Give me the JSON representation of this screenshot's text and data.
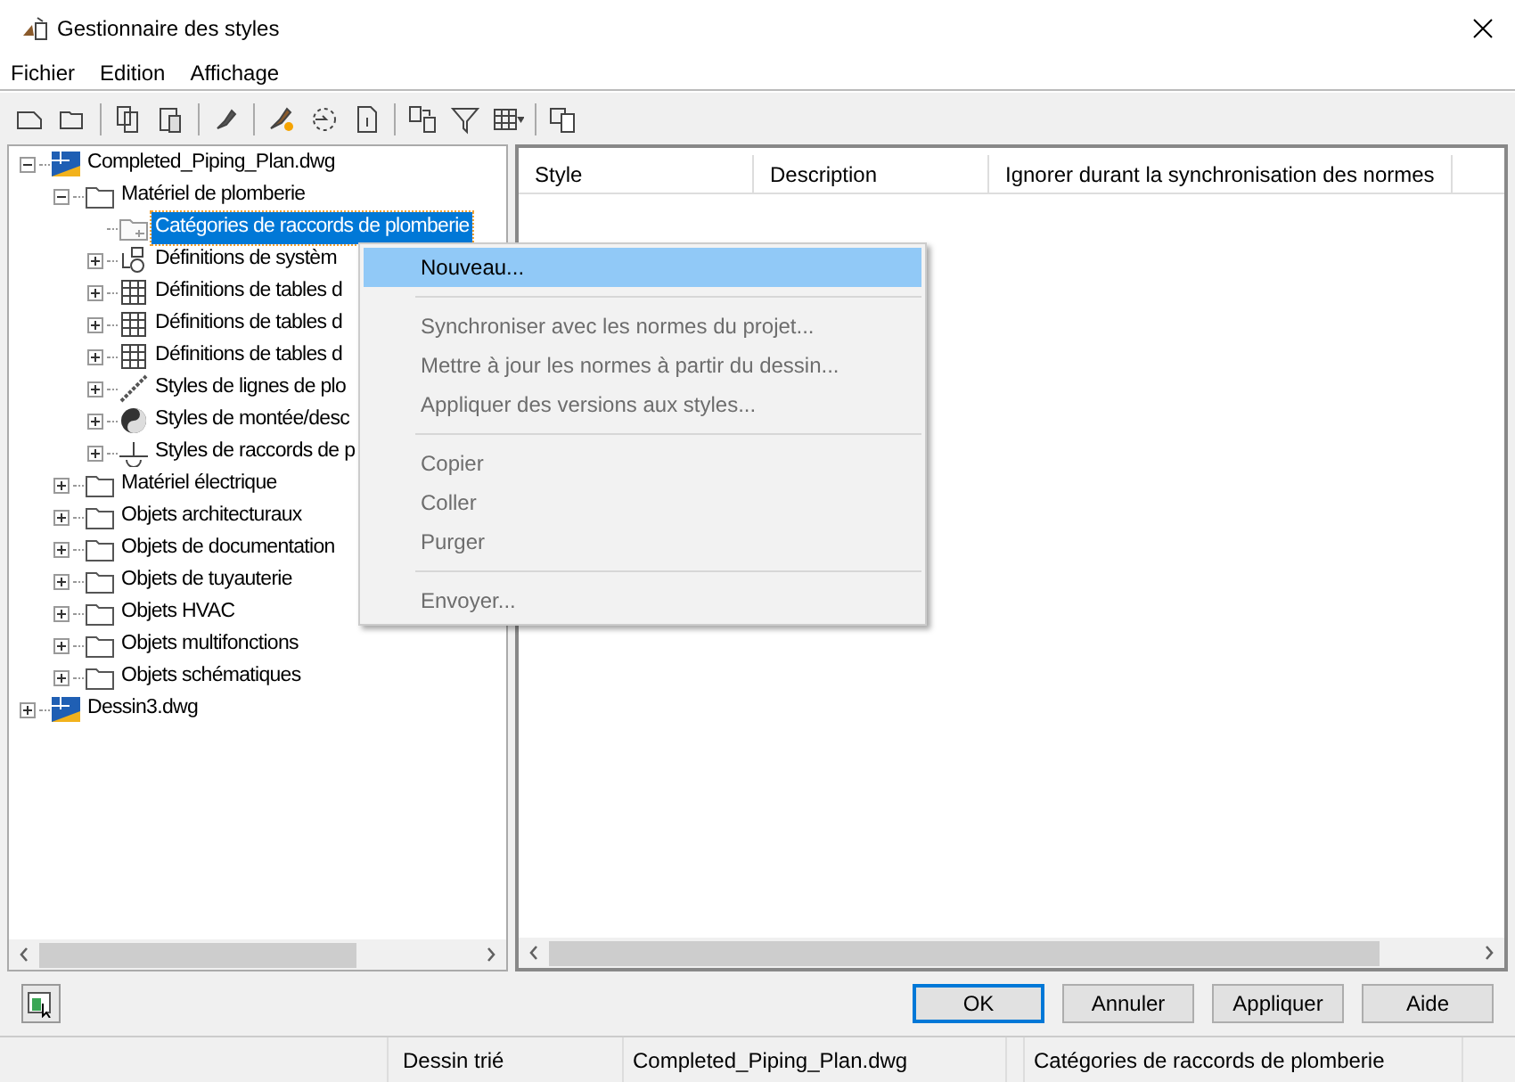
{
  "window": {
    "title": "Gestionnaire des styles"
  },
  "menu_bar": [
    "Fichier",
    "Edition",
    "Affichage"
  ],
  "tree": [
    {
      "label": "Completed_Piping_Plan.dwg",
      "kind": "file",
      "expanded": true,
      "selected": false,
      "children": [
        {
          "label": "Matériel de plomberie",
          "kind": "folder",
          "expanded": true,
          "selected": false,
          "children": [
            {
              "label": "Catégories de raccords de plomberie",
              "kind": "category",
              "selected": true
            },
            {
              "label": "Définitions de systèm",
              "kind": "system",
              "expanded": false,
              "selected": false
            },
            {
              "label": "Définitions de tables d",
              "kind": "table",
              "expanded": false,
              "selected": false
            },
            {
              "label": "Définitions de tables d",
              "kind": "table",
              "expanded": false,
              "selected": false
            },
            {
              "label": "Définitions de tables d",
              "kind": "table",
              "expanded": false,
              "selected": false
            },
            {
              "label": "Styles de lignes de plo",
              "kind": "line",
              "expanded": false,
              "selected": false
            },
            {
              "label": "Styles de montée/desc",
              "kind": "riser",
              "expanded": false,
              "selected": false
            },
            {
              "label": "Styles de raccords de p",
              "kind": "fitting",
              "expanded": false,
              "selected": false
            }
          ]
        },
        {
          "label": "Matériel électrique",
          "kind": "folder",
          "expanded": false,
          "selected": false
        },
        {
          "label": "Objets architecturaux",
          "kind": "folder",
          "expanded": false,
          "selected": false
        },
        {
          "label": "Objets de documentation",
          "kind": "folder",
          "expanded": false,
          "selected": false
        },
        {
          "label": "Objets de tuyauterie",
          "kind": "folder",
          "expanded": false,
          "selected": false
        },
        {
          "label": "Objets HVAC",
          "kind": "folder",
          "expanded": false,
          "selected": false
        },
        {
          "label": "Objets multifonctions",
          "kind": "folder",
          "expanded": false,
          "selected": false
        },
        {
          "label": "Objets schématiques",
          "kind": "folder",
          "expanded": false,
          "selected": false
        }
      ]
    },
    {
      "label": "Dessin3.dwg",
      "kind": "file",
      "expanded": false,
      "selected": false
    }
  ],
  "table": {
    "columns": [
      "Style",
      "Description",
      "Ignorer durant la synchronisation des normes"
    ]
  },
  "context_menu": [
    {
      "kind": "item",
      "label": "Nouveau...",
      "enabled": true,
      "selected": true
    },
    {
      "kind": "separator"
    },
    {
      "kind": "item",
      "label": "Synchroniser avec les normes du projet...",
      "enabled": false,
      "selected": false
    },
    {
      "kind": "item",
      "label": "Mettre à jour les normes à partir du dessin...",
      "enabled": false,
      "selected": false
    },
    {
      "kind": "item",
      "label": "Appliquer des versions aux styles...",
      "enabled": false,
      "selected": false
    },
    {
      "kind": "separator"
    },
    {
      "kind": "item",
      "label": "Copier",
      "enabled": false,
      "selected": false
    },
    {
      "kind": "item",
      "label": "Coller",
      "enabled": false,
      "selected": false
    },
    {
      "kind": "item",
      "label": "Purger",
      "enabled": false,
      "selected": false
    },
    {
      "kind": "separator"
    },
    {
      "kind": "item",
      "label": "Envoyer...",
      "enabled": false,
      "selected": false
    }
  ],
  "buttons": [
    {
      "label": "OK",
      "default": true
    },
    {
      "label": "Annuler",
      "default": false
    },
    {
      "label": "Appliquer",
      "default": false
    },
    {
      "label": "Aide",
      "default": false
    }
  ],
  "status_bar": [
    "Dessin trié",
    "Completed_Piping_Plan.dwg",
    "Catégories de raccords de plomberie"
  ]
}
